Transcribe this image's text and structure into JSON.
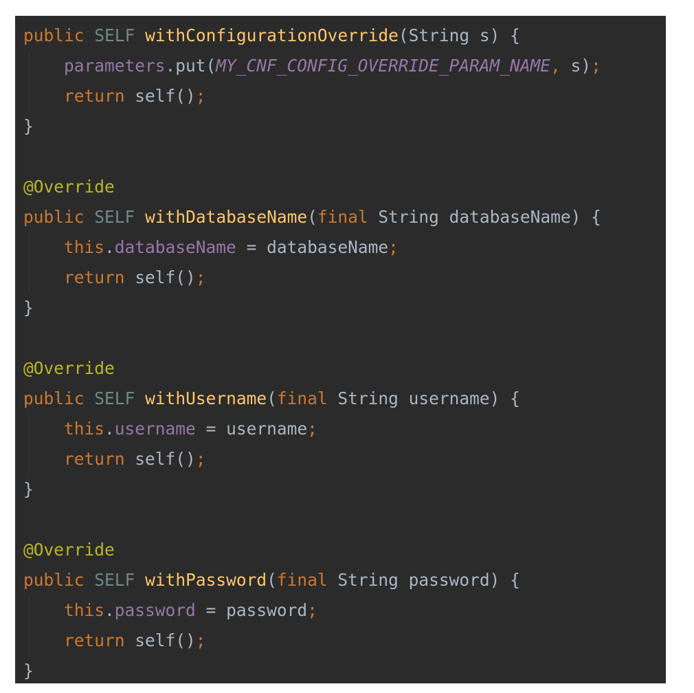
{
  "editor": {
    "theme_colors": {
      "background": "#2b2b2b",
      "keyword": "#cc7832",
      "type": "#6d8a88",
      "function": "#ffc66d",
      "identifier": "#a9b7c6",
      "field": "#9876aa",
      "annotation": "#bbb529"
    },
    "lines": [
      [
        {
          "t": "public",
          "c": "kw"
        },
        {
          "t": " ",
          "c": "plain"
        },
        {
          "t": "SELF",
          "c": "type"
        },
        {
          "t": " ",
          "c": "plain"
        },
        {
          "t": "withConfigurationOverride",
          "c": "fn"
        },
        {
          "t": "(String s) {",
          "c": "plain"
        }
      ],
      [
        {
          "t": "    ",
          "c": "plain",
          "indent": true
        },
        {
          "t": "parameters",
          "c": "field"
        },
        {
          "t": ".put(",
          "c": "plain"
        },
        {
          "t": "MY_CNF_CONFIG_OVERRIDE_PARAM_NAME",
          "c": "const"
        },
        {
          "t": ",",
          "c": "semi"
        },
        {
          "t": " s)",
          "c": "plain"
        },
        {
          "t": ";",
          "c": "semi"
        }
      ],
      [
        {
          "t": "    ",
          "c": "plain",
          "indent": true
        },
        {
          "t": "return",
          "c": "kw"
        },
        {
          "t": " self()",
          "c": "plain"
        },
        {
          "t": ";",
          "c": "semi"
        }
      ],
      [
        {
          "t": "}",
          "c": "plain"
        }
      ],
      [],
      [
        {
          "t": "@Override",
          "c": "ann"
        }
      ],
      [
        {
          "t": "public",
          "c": "kw"
        },
        {
          "t": " ",
          "c": "plain"
        },
        {
          "t": "SELF",
          "c": "type"
        },
        {
          "t": " ",
          "c": "plain"
        },
        {
          "t": "withDatabaseName",
          "c": "fn"
        },
        {
          "t": "(",
          "c": "plain"
        },
        {
          "t": "final",
          "c": "kw"
        },
        {
          "t": " String databaseName) {",
          "c": "plain"
        }
      ],
      [
        {
          "t": "    ",
          "c": "plain",
          "indent": true
        },
        {
          "t": "this",
          "c": "kw"
        },
        {
          "t": ".",
          "c": "plain"
        },
        {
          "t": "databaseName",
          "c": "field"
        },
        {
          "t": " = databaseName",
          "c": "plain"
        },
        {
          "t": ";",
          "c": "semi"
        }
      ],
      [
        {
          "t": "    ",
          "c": "plain",
          "indent": true
        },
        {
          "t": "return",
          "c": "kw"
        },
        {
          "t": " self()",
          "c": "plain"
        },
        {
          "t": ";",
          "c": "semi"
        }
      ],
      [
        {
          "t": "}",
          "c": "plain"
        }
      ],
      [],
      [
        {
          "t": "@Override",
          "c": "ann"
        }
      ],
      [
        {
          "t": "public",
          "c": "kw"
        },
        {
          "t": " ",
          "c": "plain"
        },
        {
          "t": "SELF",
          "c": "type"
        },
        {
          "t": " ",
          "c": "plain"
        },
        {
          "t": "withUsername",
          "c": "fn"
        },
        {
          "t": "(",
          "c": "plain"
        },
        {
          "t": "final",
          "c": "kw"
        },
        {
          "t": " String username) {",
          "c": "plain"
        }
      ],
      [
        {
          "t": "    ",
          "c": "plain",
          "indent": true
        },
        {
          "t": "this",
          "c": "kw"
        },
        {
          "t": ".",
          "c": "plain"
        },
        {
          "t": "username",
          "c": "field"
        },
        {
          "t": " = username",
          "c": "plain"
        },
        {
          "t": ";",
          "c": "semi"
        }
      ],
      [
        {
          "t": "    ",
          "c": "plain",
          "indent": true
        },
        {
          "t": "return",
          "c": "kw"
        },
        {
          "t": " self()",
          "c": "plain"
        },
        {
          "t": ";",
          "c": "semi"
        }
      ],
      [
        {
          "t": "}",
          "c": "plain"
        }
      ],
      [],
      [
        {
          "t": "@Override",
          "c": "ann"
        }
      ],
      [
        {
          "t": "public",
          "c": "kw"
        },
        {
          "t": " ",
          "c": "plain"
        },
        {
          "t": "SELF",
          "c": "type"
        },
        {
          "t": " ",
          "c": "plain"
        },
        {
          "t": "withPassword",
          "c": "fn"
        },
        {
          "t": "(",
          "c": "plain"
        },
        {
          "t": "final",
          "c": "kw"
        },
        {
          "t": " String password) {",
          "c": "plain"
        }
      ],
      [
        {
          "t": "    ",
          "c": "plain",
          "indent": true
        },
        {
          "t": "this",
          "c": "kw"
        },
        {
          "t": ".",
          "c": "plain"
        },
        {
          "t": "password",
          "c": "field"
        },
        {
          "t": " = password",
          "c": "plain"
        },
        {
          "t": ";",
          "c": "semi"
        }
      ],
      [
        {
          "t": "    ",
          "c": "plain",
          "indent": true
        },
        {
          "t": "return",
          "c": "kw"
        },
        {
          "t": " self()",
          "c": "plain"
        },
        {
          "t": ";",
          "c": "semi"
        }
      ],
      [
        {
          "t": "}",
          "c": "plain"
        }
      ]
    ]
  }
}
